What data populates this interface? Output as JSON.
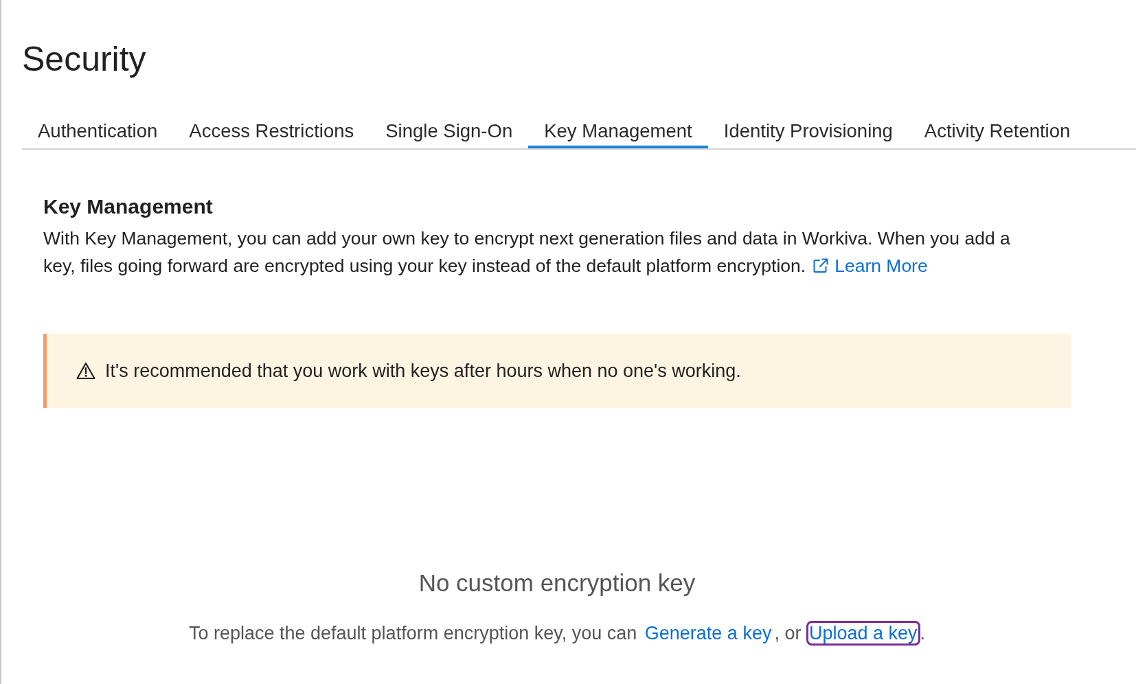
{
  "page": {
    "title": "Security"
  },
  "tabs": [
    {
      "label": "Authentication",
      "selected": false
    },
    {
      "label": "Access Restrictions",
      "selected": false
    },
    {
      "label": "Single Sign-On",
      "selected": false
    },
    {
      "label": "Key Management",
      "selected": true
    },
    {
      "label": "Identity Provisioning",
      "selected": false
    },
    {
      "label": "Activity Retention",
      "selected": false
    }
  ],
  "section": {
    "heading": "Key Management",
    "description": "With Key Management, you can add your own key to encrypt next generation files and data in Workiva. When you add a key, files going forward are encrypted using your key instead of the default platform encryption.",
    "link": {
      "label": "Learn More"
    }
  },
  "alert": {
    "kind": "warning",
    "message": "It's recommended that you work with keys after hours when no one's working."
  },
  "empty_state": {
    "title": "No custom encryption key",
    "parts": [
      {
        "kind": "text",
        "text": "To replace the default platform encryption key, you can "
      },
      {
        "kind": "link",
        "text": "Generate a key",
        "focused": false
      },
      {
        "kind": "text",
        "text": ", or "
      },
      {
        "kind": "link",
        "text": "Upload a key",
        "focused": true
      },
      {
        "kind": "text",
        "text": "."
      }
    ]
  }
}
